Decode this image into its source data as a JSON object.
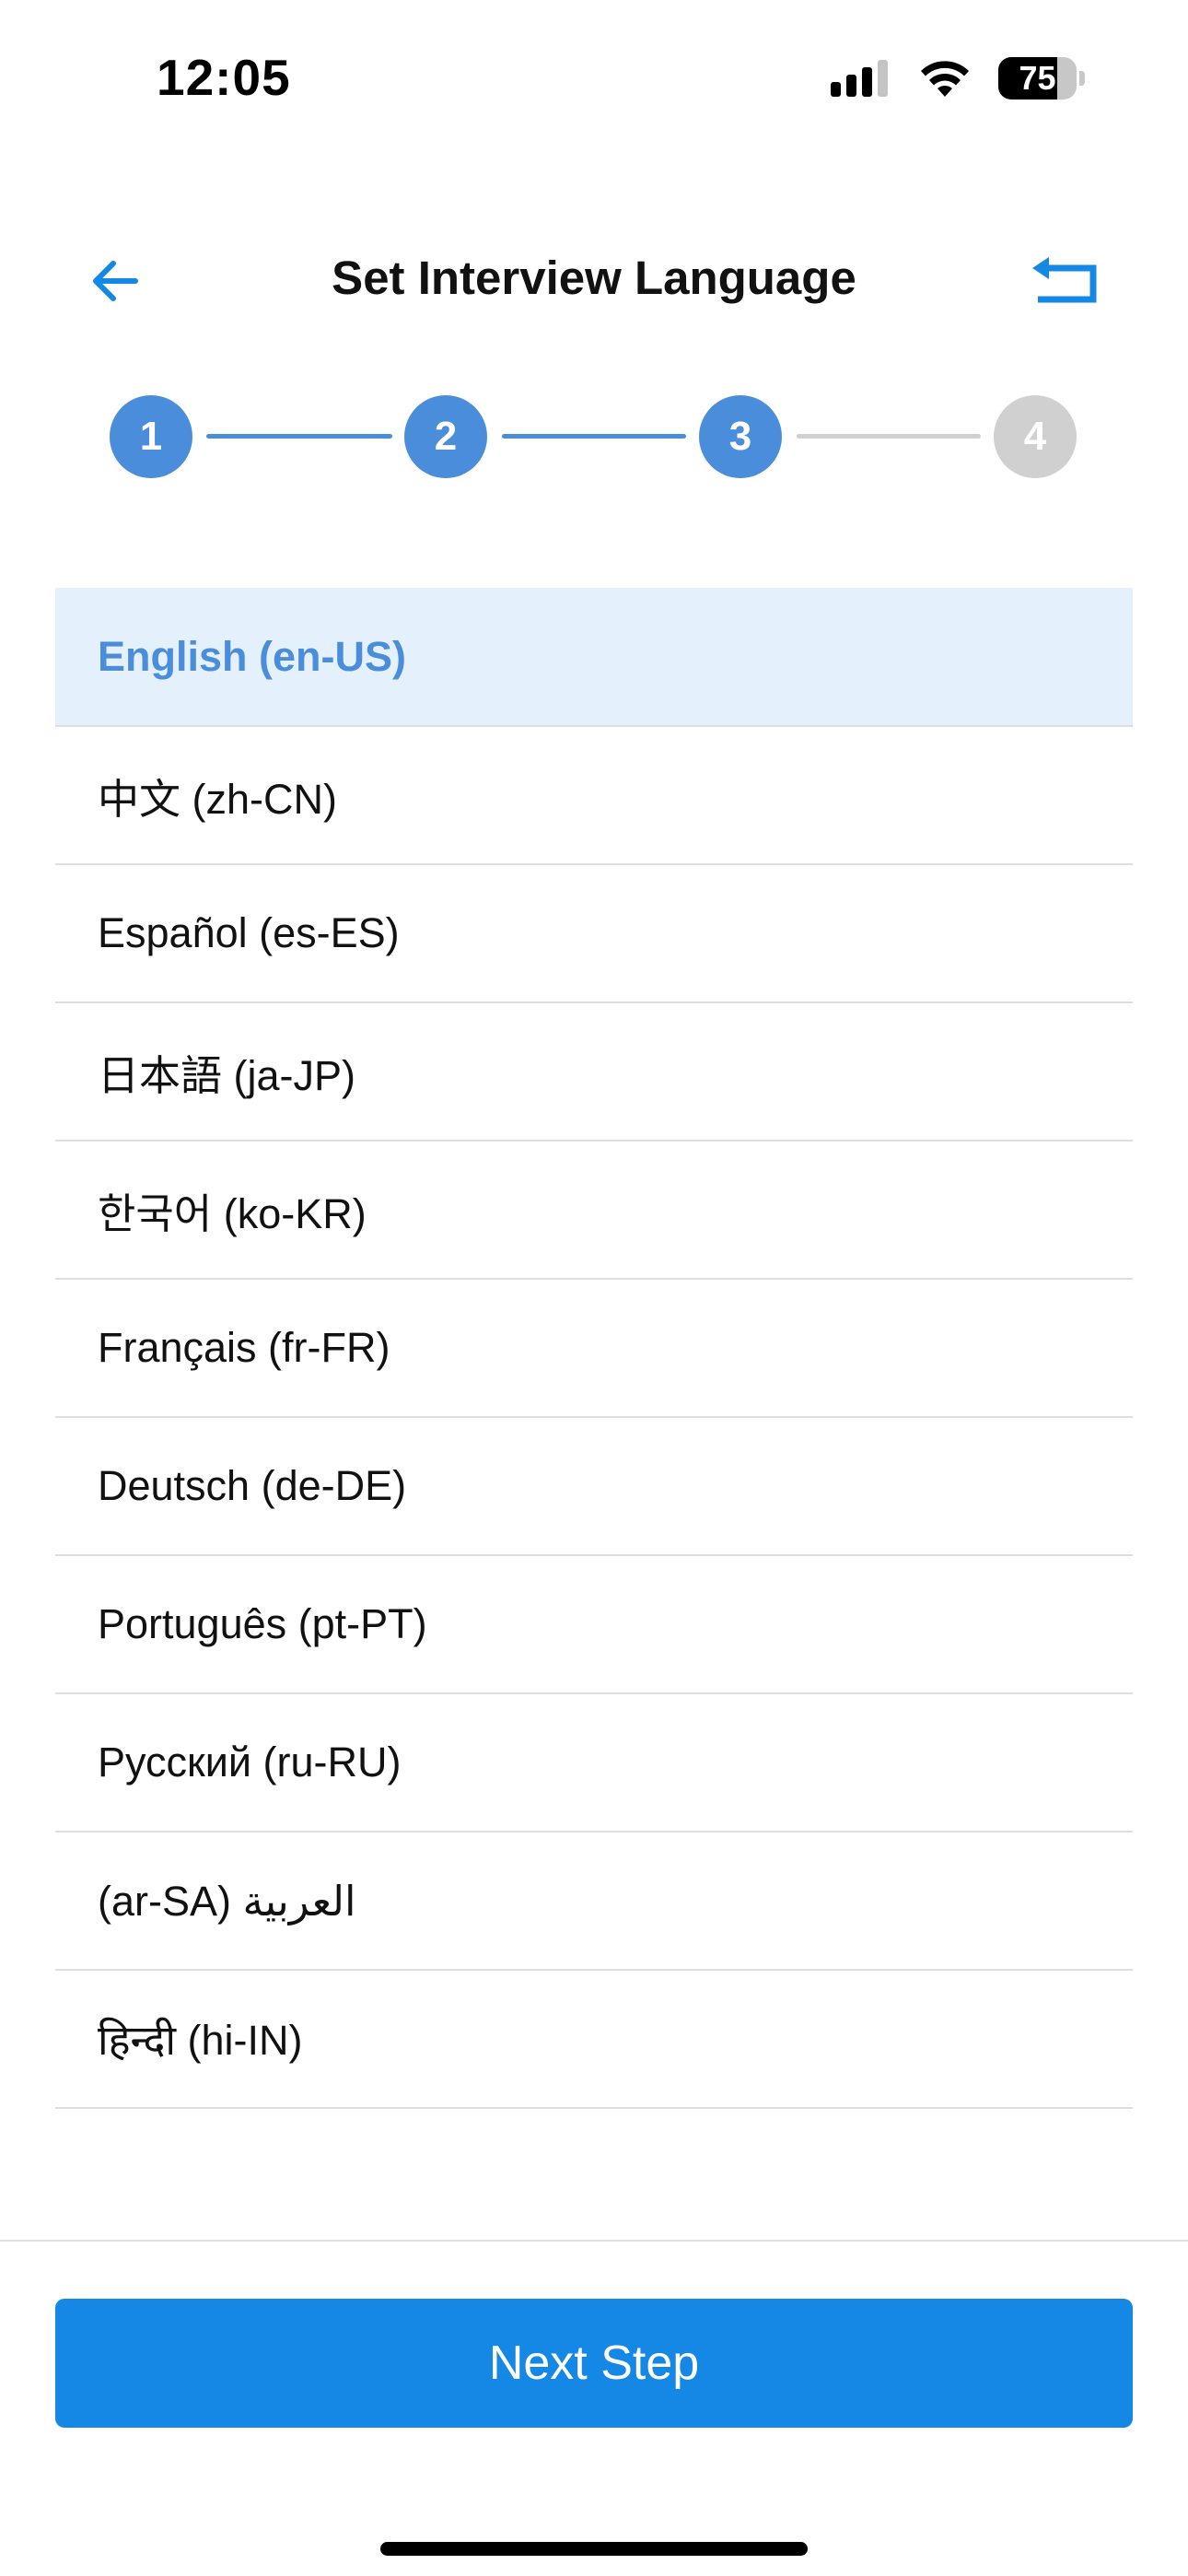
{
  "status_bar": {
    "time": "12:05",
    "battery_level": 75,
    "battery_text": "75",
    "icons": [
      "cellular-signal-icon",
      "wifi-icon",
      "battery-icon"
    ]
  },
  "header": {
    "title": "Set Interview Language",
    "back_icon": "arrow-left-icon",
    "reset_icon": "return-arrow-icon"
  },
  "stepper": {
    "current_step": 3,
    "steps": [
      {
        "label": "1",
        "state": "complete"
      },
      {
        "label": "2",
        "state": "complete"
      },
      {
        "label": "3",
        "state": "active"
      },
      {
        "label": "4",
        "state": "pending"
      }
    ]
  },
  "languages": {
    "selected_index": 0,
    "items": [
      {
        "label": "English (en-US)"
      },
      {
        "label": "中文 (zh-CN)"
      },
      {
        "label": "Español (es-ES)"
      },
      {
        "label": "日本語 (ja-JP)"
      },
      {
        "label": "한국어 (ko-KR)"
      },
      {
        "label": "Français (fr-FR)"
      },
      {
        "label": "Deutsch (de-DE)"
      },
      {
        "label": "Português (pt-PT)"
      },
      {
        "label": "Русский (ru-RU)"
      },
      {
        "label": "العربية (ar-SA)"
      },
      {
        "label": "हिन्दी (hi-IN)"
      }
    ]
  },
  "footer": {
    "next_label": "Next Step"
  },
  "colors": {
    "accent": "#1488e4",
    "step_active": "#4a8edb",
    "step_pending": "#d0d0d0",
    "selected_row_bg": "#e4f0fc",
    "selected_row_text": "#4a8edb"
  }
}
